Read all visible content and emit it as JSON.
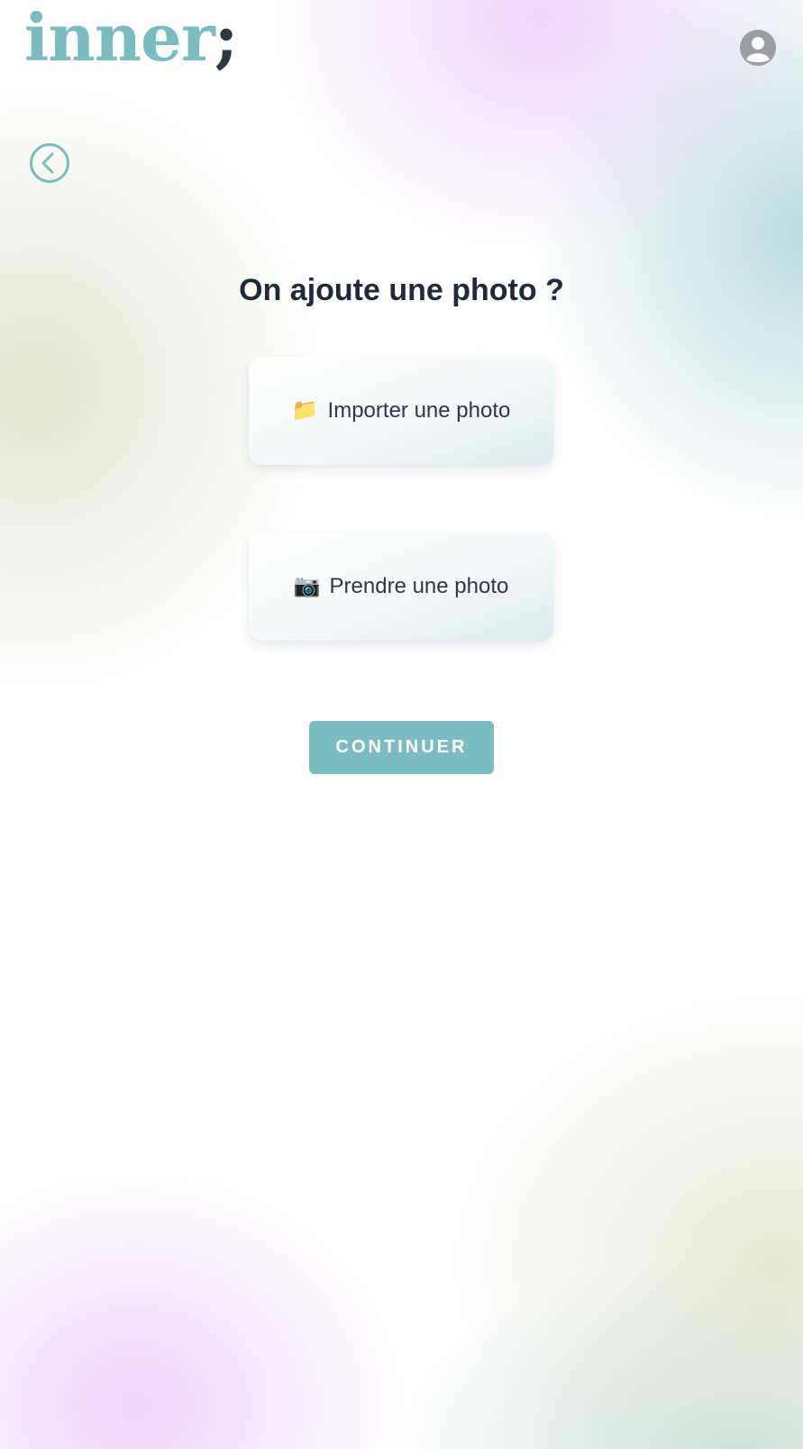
{
  "app": {
    "logo_text": "inner",
    "logo_semicolon": ";"
  },
  "colors": {
    "accent": "#7bbcc0",
    "title": "#1f2a3a",
    "profile": "#9c9ca3"
  },
  "icons": {
    "profile": "user-circle-icon",
    "back": "chevron-left-circle-icon",
    "import": "folder-icon",
    "take": "camera-icon"
  },
  "main": {
    "title": "On ajoute une photo ?",
    "options": [
      {
        "emoji": "📁",
        "label": "Importer une photo"
      },
      {
        "emoji": "📷",
        "label": "Prendre une photo"
      }
    ],
    "continue_label": "CONTINUER"
  }
}
